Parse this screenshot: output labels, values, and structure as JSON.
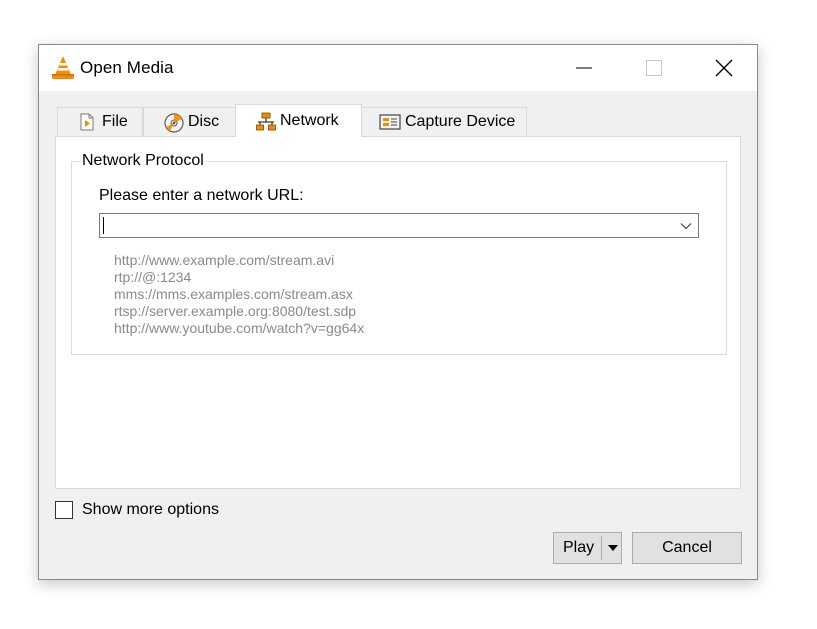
{
  "window": {
    "title": "Open Media",
    "app_icon": "vlc-cone-icon"
  },
  "tabs": [
    {
      "label": "File",
      "icon": "file-play-icon",
      "selected": false
    },
    {
      "label": "Disc",
      "icon": "disc-icon",
      "selected": false
    },
    {
      "label": "Network",
      "icon": "network-icon",
      "selected": true
    },
    {
      "label": "Capture Device",
      "icon": "capture-device-icon",
      "selected": false
    }
  ],
  "network": {
    "group_title": "Network Protocol",
    "url_label": "Please enter a network URL:",
    "url_value": "",
    "examples": [
      "http://www.example.com/stream.avi",
      "rtp://@:1234",
      "mms://mms.examples.com/stream.asx",
      "rtsp://server.example.org:8080/test.sdp",
      "http://www.youtube.com/watch?v=gg64x"
    ]
  },
  "options": {
    "show_more_label": "Show more options",
    "show_more_checked": false
  },
  "buttons": {
    "play_label": "Play",
    "cancel_label": "Cancel"
  },
  "colors": {
    "accent_orange": "#f28c00",
    "hint_text": "#8a8a8a",
    "dialog_bg": "#f0f0f0"
  }
}
